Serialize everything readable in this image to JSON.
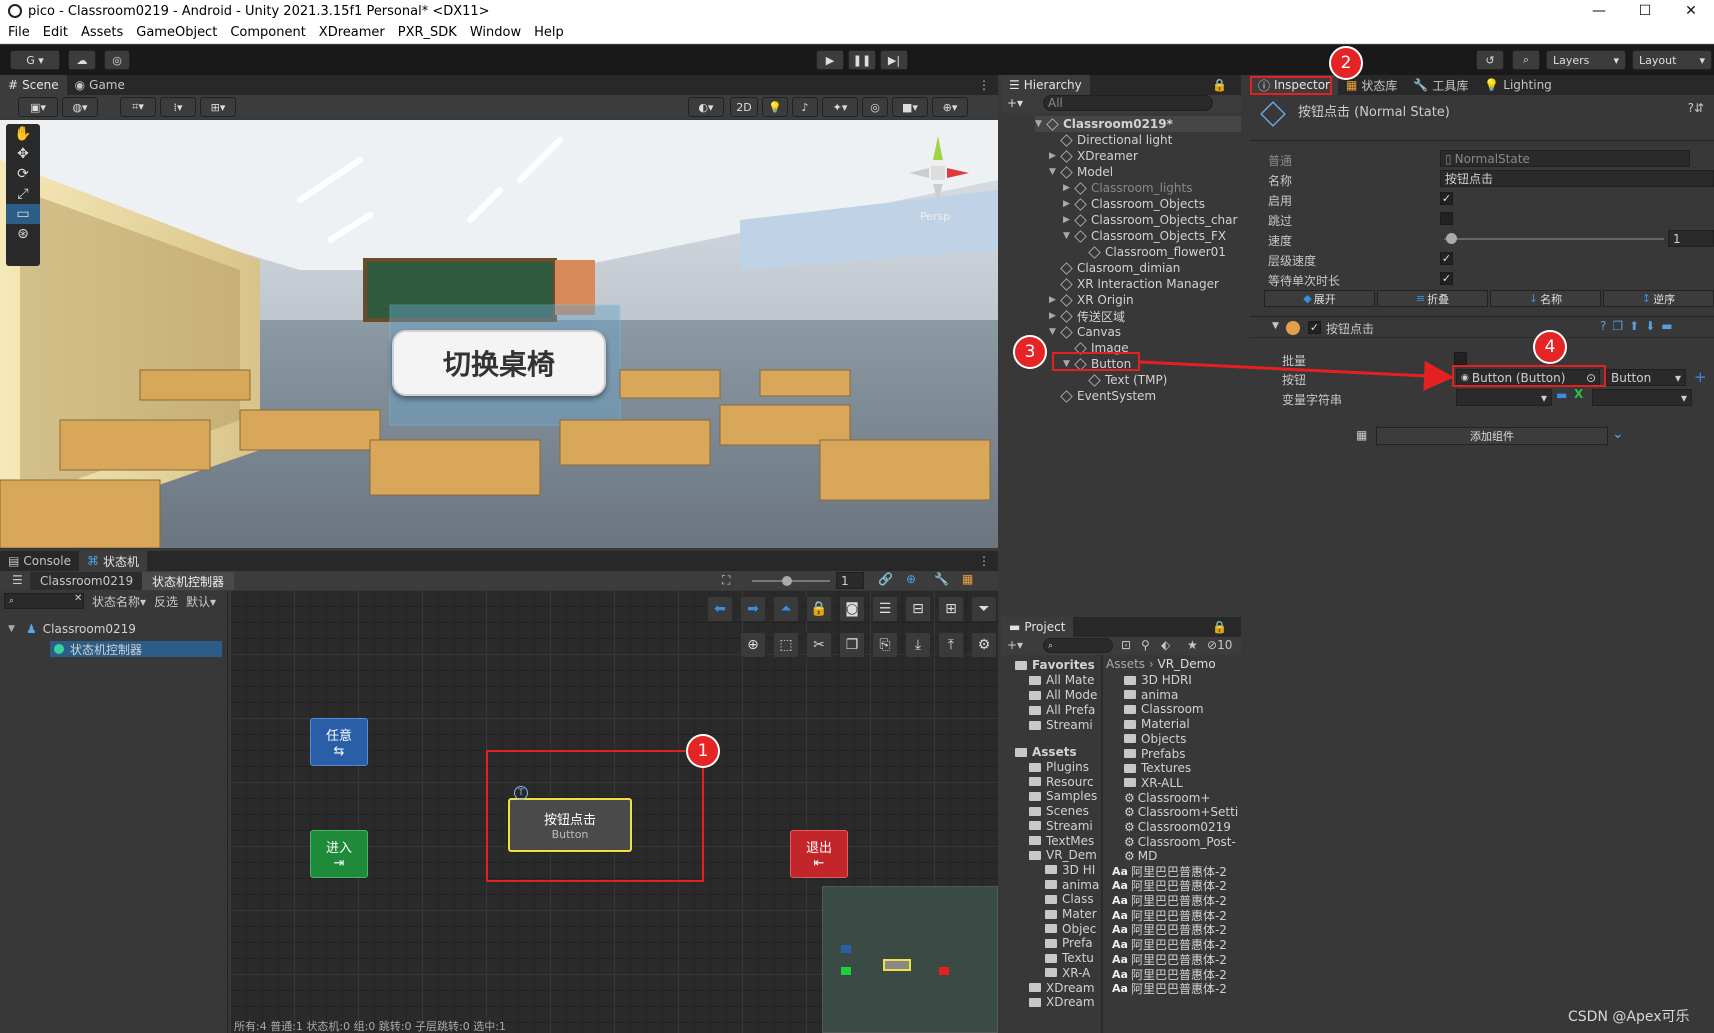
{
  "window": {
    "title": "pico - Classroom0219 - Android - Unity 2021.3.15f1 Personal* <DX11>",
    "min": "—",
    "max": "☐",
    "close": "✕"
  },
  "menu": [
    "File",
    "Edit",
    "Assets",
    "GameObject",
    "Component",
    "XDreamer",
    "PXR_SDK",
    "Window",
    "Help"
  ],
  "toolbar": {
    "account": "G ▾",
    "layers": "Layers",
    "layout": "Layout"
  },
  "scene": {
    "tab_scene": "Scene",
    "tab_game": "Game",
    "mode_2d": "2D",
    "persp": "Persp",
    "sign_text": "切换桌椅"
  },
  "hierarchy": {
    "tab": "Hierarchy",
    "search": "All",
    "items": [
      {
        "label": "Classroom0219*",
        "depth": 0,
        "arrow": "▼"
      },
      {
        "label": "Directional light",
        "depth": 1,
        "arrow": ""
      },
      {
        "label": "XDreamer",
        "depth": 1,
        "arrow": "▶"
      },
      {
        "label": "Model",
        "depth": 1,
        "arrow": "▼"
      },
      {
        "label": "Classroom_lights",
        "depth": 2,
        "arrow": "▶"
      },
      {
        "label": "Classroom_Objects",
        "depth": 2,
        "arrow": "▶"
      },
      {
        "label": "Classroom_Objects_char",
        "depth": 2,
        "arrow": "▶"
      },
      {
        "label": "Classroom_Objects_FX",
        "depth": 2,
        "arrow": "▼"
      },
      {
        "label": "Classroom_flower01",
        "depth": 3,
        "arrow": ""
      },
      {
        "label": "Clasroom_dimian",
        "depth": 1,
        "arrow": ""
      },
      {
        "label": "XR Interaction Manager",
        "depth": 1,
        "arrow": ""
      },
      {
        "label": "XR Origin",
        "depth": 1,
        "arrow": "▶"
      },
      {
        "label": "传送区域",
        "depth": 1,
        "arrow": "▶"
      },
      {
        "label": "Canvas",
        "depth": 1,
        "arrow": "▼"
      },
      {
        "label": "Image",
        "depth": 2,
        "arrow": ""
      },
      {
        "label": "Button",
        "depth": 2,
        "arrow": "▼"
      },
      {
        "label": "Text (TMP)",
        "depth": 3,
        "arrow": ""
      },
      {
        "label": "EventSystem",
        "depth": 1,
        "arrow": ""
      }
    ]
  },
  "inspector": {
    "tabs": [
      "Inspector",
      "状态库",
      "工具库",
      "Lighting"
    ],
    "title": "按钮点击 (Normal State)",
    "rows": {
      "common": "普通",
      "common_val": "NormalState",
      "name": "名称",
      "name_val": "按钮点击",
      "enable": "启用",
      "skip": "跳过",
      "speed": "速度",
      "speed_val": "1",
      "level_speed": "层级速度",
      "wait": "等待单次时长"
    },
    "buttons": [
      "展开",
      "折叠",
      "名称",
      "逆序"
    ],
    "component": "按钮点击",
    "batch": "批量",
    "button": "按钮",
    "button_val": "Button (Button)",
    "button_type": "Button",
    "var_str": "变量字符串",
    "add_component": "添加组件"
  },
  "bottom": {
    "tab_console": "Console",
    "tab_fsm": "状态机",
    "bc1": "Classroom0219",
    "bc2": "状态机控制器",
    "zoom": "1",
    "filter_name": "状态名称▾",
    "filter_invert": "反选",
    "filter_default": "默认▾",
    "tree_root": "Classroom0219",
    "tree_child": "状态机控制器",
    "nodes": {
      "any": "任意",
      "enter": "进入",
      "exit": "退出",
      "state": "按钮点击",
      "state_sub": "Button"
    },
    "status": "所有:4 普通:1 状态机:0 组:0 跳转:0 子层跳转:0 选中:1"
  },
  "project": {
    "tab": "Project",
    "hidden_count": "10",
    "favorites": "Favorites",
    "fav_items": [
      "All Mate",
      "All Mode",
      "All Prefa",
      "Streami"
    ],
    "assets": "Assets",
    "tree": [
      "Plugins",
      "Resourc",
      "Samples",
      "Scenes",
      "Streami",
      "TextMes",
      "VR_Dem",
      "3D HI",
      "anima",
      "Class",
      "Mater",
      "Objec",
      "Prefa",
      "Textu",
      "XR-A",
      "XDream",
      "XDream"
    ],
    "bc_assets": "Assets",
    "bc_vr": "VR_Demo",
    "files": [
      "3D HDRI",
      "anima",
      "Classroom",
      "Material",
      "Objects",
      "Prefabs",
      "Textures",
      "XR-ALL",
      "Classroom+",
      "Classroom+Setti",
      "Classroom0219",
      "Classroom_Post-",
      "MD",
      "阿里巴巴普惠体-2",
      "阿里巴巴普惠体-2",
      "阿里巴巴普惠体-2",
      "阿里巴巴普惠体-2",
      "阿里巴巴普惠体-2",
      "阿里巴巴普惠体-2",
      "阿里巴巴普惠体-2",
      "阿里巴巴普惠体-2",
      "阿里巴巴普惠体-2"
    ]
  },
  "annotations": [
    "1",
    "2",
    "3",
    "4"
  ],
  "watermark": "CSDN @Apex可乐",
  "colors": {
    "red": "#e52020",
    "selected": "#2c5d87",
    "node_blue": "#2a5fa8",
    "node_green": "#1e8a3a",
    "node_red": "#c2262b",
    "node_state": "#4a4a4a",
    "highlight": "#f0e040"
  }
}
